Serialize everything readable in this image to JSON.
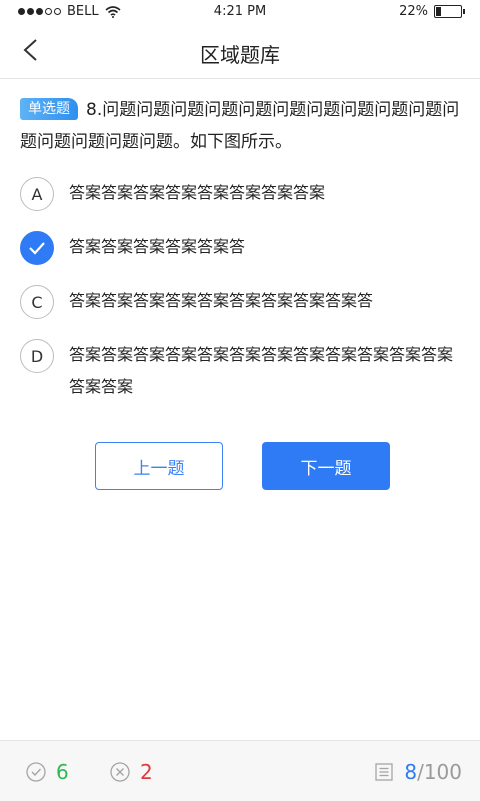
{
  "status_bar": {
    "carrier": "BELL",
    "time": "4:21 PM",
    "battery": "22%",
    "battery_level": 0.22
  },
  "header": {
    "title": "区域题库"
  },
  "question": {
    "type_label": "单选题",
    "text": "8.问题问题问题问题问题问题问题问题问题问题问题问题问题问题问题。如下图所示。"
  },
  "options": [
    {
      "label": "A",
      "text": "答案答案答案答案答案答案答案答案",
      "selected": false
    },
    {
      "label": "B",
      "text": "答案答案答案答案答案答",
      "selected": true
    },
    {
      "label": "C",
      "text": "答案答案答案答案答案答案答案答案答案答",
      "selected": false
    },
    {
      "label": "D",
      "text": "答案答案答案答案答案答案答案答案答案答案答案答案答案答案",
      "selected": false
    }
  ],
  "buttons": {
    "prev": "上一题",
    "next": "下一题"
  },
  "footer": {
    "correct_count": "6",
    "wrong_count": "2",
    "current": "8",
    "total": "/100"
  },
  "colors": {
    "accent": "#2f7bf5",
    "correct": "#2eb84f",
    "wrong": "#e23838"
  }
}
